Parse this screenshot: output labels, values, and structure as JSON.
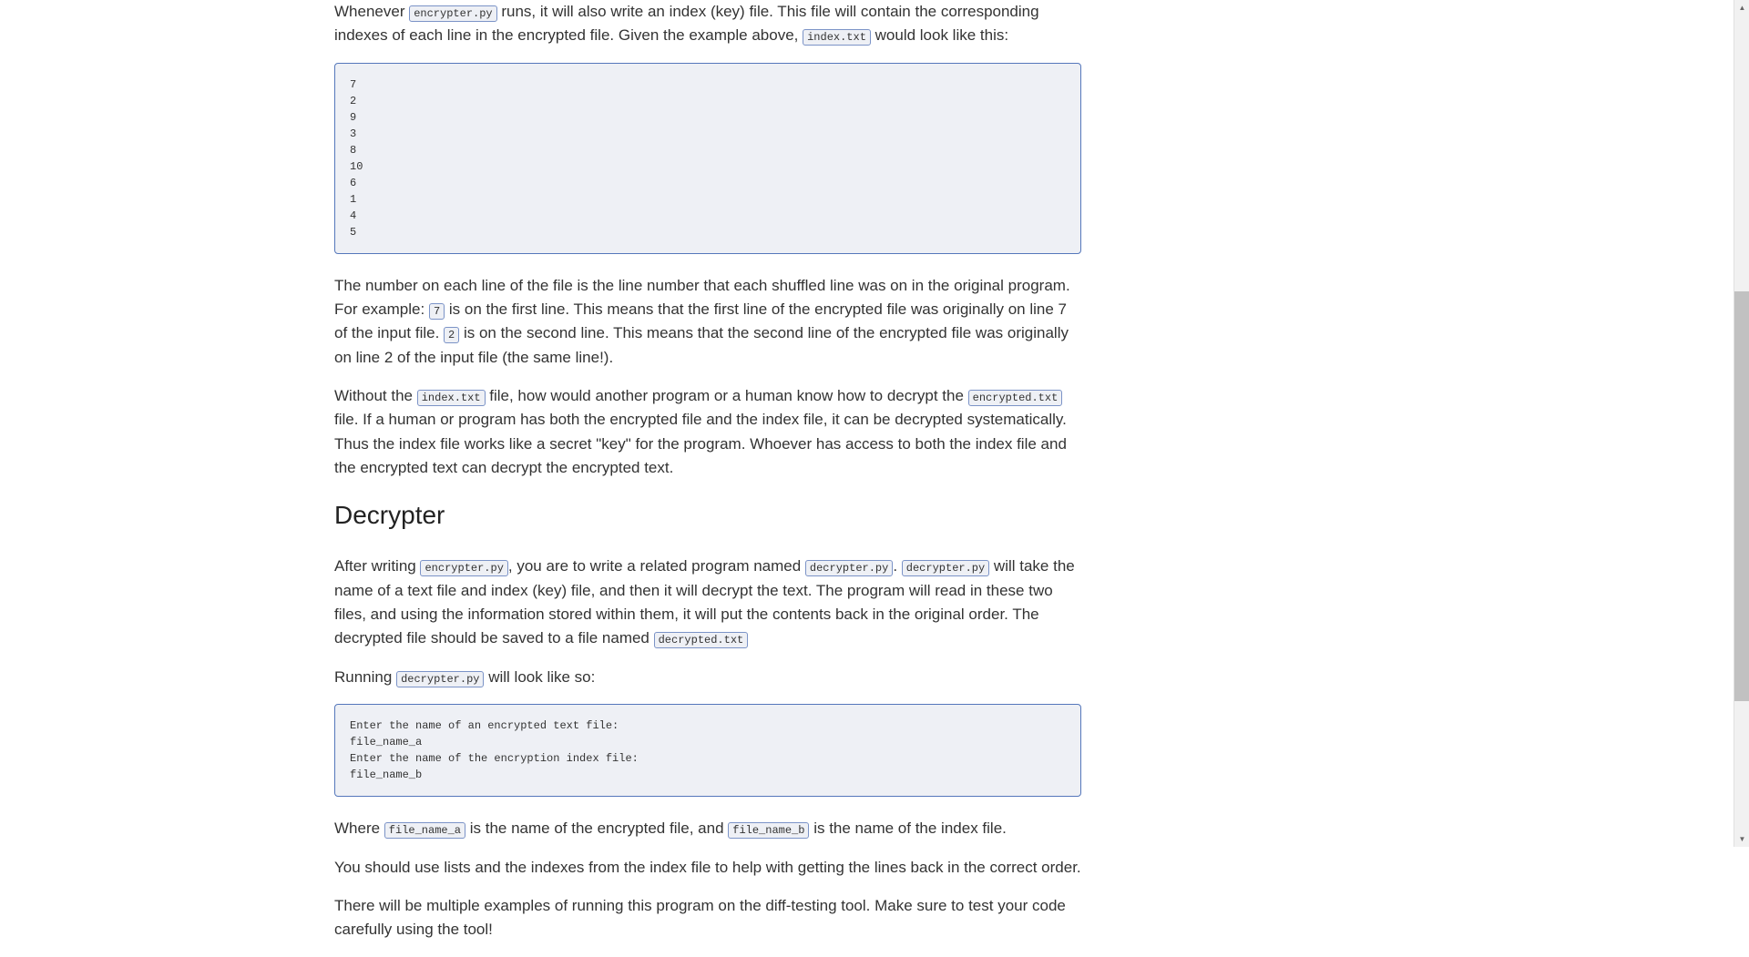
{
  "para1": {
    "t1": "Whenever ",
    "c1": "encrypter.py",
    "t2": " runs, it will also write an index (key) file. This file will contain the corresponding indexes of each line in the encrypted file. Given the example above, ",
    "c2": "index.txt",
    "t3": " would look like this:"
  },
  "codeblock1": "7\n2\n9\n3\n8\n10\n6\n1\n4\n5",
  "para2": {
    "t1": "The number on each line of the file is the line number that each shuffled line was on in the original program. For example: ",
    "c1": "7",
    "t2": " is on the first line. This means that the first line of the encrypted file was originally on line 7 of the input file. ",
    "c2": "2",
    "t3": " is on the second line. This means that the second line of the encrypted file was originally on line 2 of the input file (the same line!)."
  },
  "para3": {
    "t1": "Without the ",
    "c1": "index.txt",
    "t2": " file, how would another program or a human know how to decrypt the ",
    "c2": "encrypted.txt",
    "t3": " file. If a human or program has both the encrypted file and the index file, it can be decrypted systematically. Thus the index file works like a secret \"key\" for the program. Whoever has access to both the index file and the encrypted text can decrypt the encrypted text."
  },
  "heading1": "Decrypter",
  "para4": {
    "t1": "After writing ",
    "c1": "encrypter.py",
    "t2": ", you are to write a related program named ",
    "c2": "decrypter.py",
    "t3": ". ",
    "c3": "decrypter.py",
    "t4": " will take the name of a text file and index (key) file, and then it will decrypt the text. The program will read in these two files, and using the information stored within them, it will put the contents back in the original order. The decrypted file should be saved to a file named ",
    "c4": "decrypted.txt"
  },
  "para5": {
    "t1": "Running ",
    "c1": "decrypter.py",
    "t2": " will look like so:"
  },
  "codeblock2": "Enter the name of an encrypted text file:\nfile_name_a\nEnter the name of the encryption index file:\nfile_name_b",
  "para6": {
    "t1": "Where ",
    "c1": "file_name_a",
    "t2": " is the name of the encrypted file, and ",
    "c2": "file_name_b",
    "t3": " is the name of the index file."
  },
  "para7": {
    "t1": "You should use lists and the indexes from the index file to help with getting the lines back in the correct order."
  },
  "para8": {
    "t1": "There will be multiple examples of running this program on the diff-testing tool. Make sure to test your code carefully using the tool!"
  }
}
